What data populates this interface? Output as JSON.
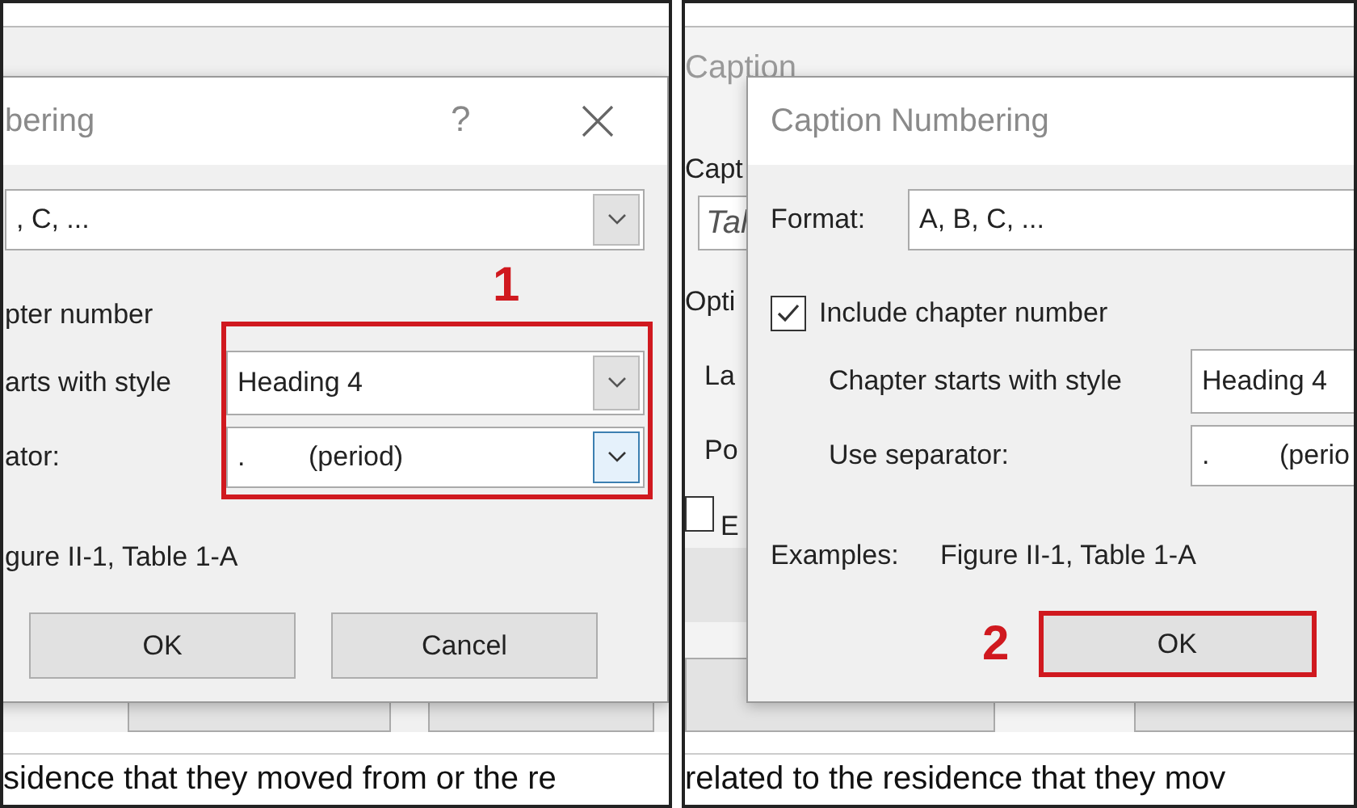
{
  "left_panel": {
    "dialog": {
      "title": "bering",
      "help": "?",
      "format_value": ", C, ...",
      "include_chapter_label": "pter number",
      "chapter_style_label": "arts with style",
      "chapter_style_value": "Heading 4",
      "separator_label": "ator:",
      "separator_value": ".",
      "separator_desc": "(period)",
      "separator_dropdown_focused": true,
      "examples": "gure II-1, Table 1-A",
      "buttons": [
        "OK",
        "Cancel"
      ]
    },
    "callout": "1",
    "document_text": "sidence that they moved from or the re"
  },
  "right_panel": {
    "background_dialog": {
      "title": "Caption",
      "caption_label": "Capt",
      "caption_value": "Tal",
      "options_label": "Opti",
      "label_label": "La",
      "position_label": "Po",
      "exclude_checked": false,
      "exclude_label": "E"
    },
    "dialog": {
      "title": "Caption Numbering",
      "format_label": "Format:",
      "format_value": "A, B, C, ...",
      "include_chapter": {
        "label": "Include chapter number",
        "checked": true
      },
      "chapter_style_label": "Chapter starts with style",
      "chapter_style_value": "Heading 4",
      "separator_label": "Use separator:",
      "separator_value": ".",
      "separator_desc": "(perio",
      "examples_label": "Examples:",
      "examples_value": "Figure II-1, Table 1-A",
      "ok_button": "OK"
    },
    "callout": "2",
    "document_text": "related to the residence that they mov"
  }
}
